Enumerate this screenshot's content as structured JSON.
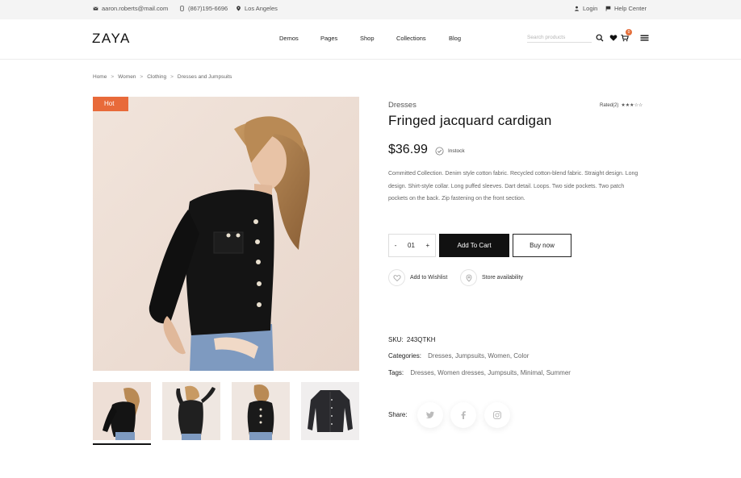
{
  "topbar": {
    "email": "aaron.roberts@mail.com",
    "phone": "(867)195-6696",
    "location": "Los Angeles",
    "login": "Login",
    "help": "Help Center"
  },
  "header": {
    "logo": "ZAYA",
    "nav": [
      "Demos",
      "Pages",
      "Shop",
      "Collections",
      "Blog"
    ],
    "search_placeholder": "Search products",
    "cart_count": "0"
  },
  "breadcrumb": [
    "Home",
    "Women",
    "Clothing",
    "Dresses and Jumpsuits"
  ],
  "gallery": {
    "badge": "Hot",
    "thumbnails": 4,
    "active_index": 0
  },
  "product": {
    "category": "Dresses",
    "title": "Fringed jacquard cardigan",
    "rated": "Rated(2)",
    "stars": "★★★☆☆",
    "rating": 3,
    "price": "$36.99",
    "stock": "Instock",
    "description": "Committed Collection. Denim style cotton fabric. Recycled cotton-blend fabric. Straight design. Long design. Shirt-style collar. Long puffed sleeves. Dart detail. Loops. Two side pockets. Two patch pockets on the back. Zip fastening on the front section.",
    "qty_minus": "-",
    "qty": "01",
    "qty_plus": "+",
    "add_to_cart": "Add To Cart",
    "buy_now": "Buy now",
    "wishlist": "Add to Wishlist",
    "store": "Store availability",
    "sku_label": "SKU:",
    "sku": "243QTKH",
    "categories_label": "Categories:",
    "categories": "Dresses, Jumpsuits, Women, Color",
    "tags_label": "Tags:",
    "tags": "Dresses, Women dresses, Jumpsuits, Minimal, Summer",
    "share_label": "Share:"
  },
  "colors": {
    "accent": "#e86a3a",
    "dark": "#111111",
    "bg_topbar": "#f4f4f4"
  }
}
